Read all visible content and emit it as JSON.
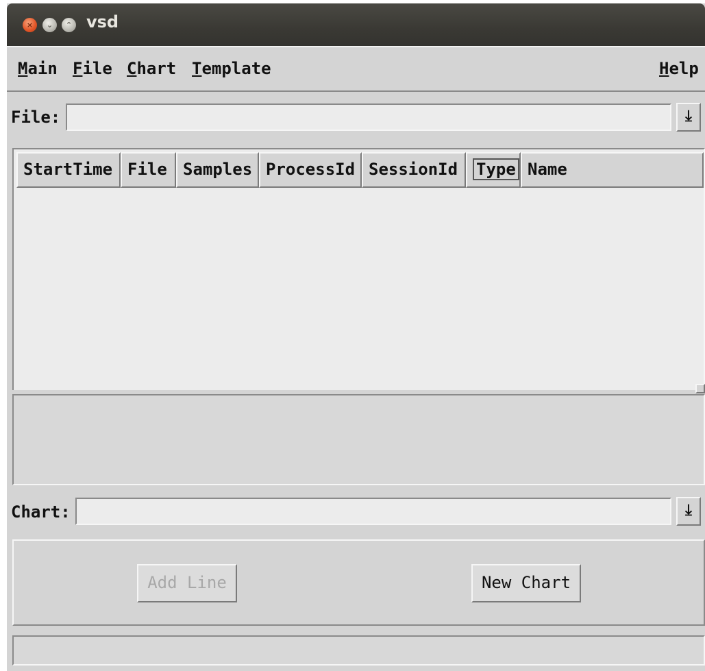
{
  "window": {
    "title": "vsd"
  },
  "menubar": {
    "items": [
      {
        "key": "M",
        "rest": "ain"
      },
      {
        "key": "F",
        "rest": "ile"
      },
      {
        "key": "C",
        "rest": "hart"
      },
      {
        "key": "T",
        "rest": "emplate"
      }
    ],
    "help": {
      "key": "H",
      "rest": "elp"
    }
  },
  "file_row": {
    "label": "File:",
    "value": "",
    "dropdown_icon": "download-arrow-icon"
  },
  "table": {
    "columns": [
      "StartTime",
      "File",
      "Samples",
      "ProcessId",
      "SessionId",
      "Type",
      "Name"
    ],
    "rows": []
  },
  "chart_row": {
    "label": "Chart:",
    "value": "",
    "dropdown_icon": "download-arrow-icon"
  },
  "buttons": {
    "add_line": "Add Line",
    "new_chart": "New Chart"
  },
  "status": {
    "text": ""
  },
  "colors": {
    "titlebar": "#3c3b37",
    "close": "#e4582a",
    "window_bg": "#d4d4d4"
  }
}
